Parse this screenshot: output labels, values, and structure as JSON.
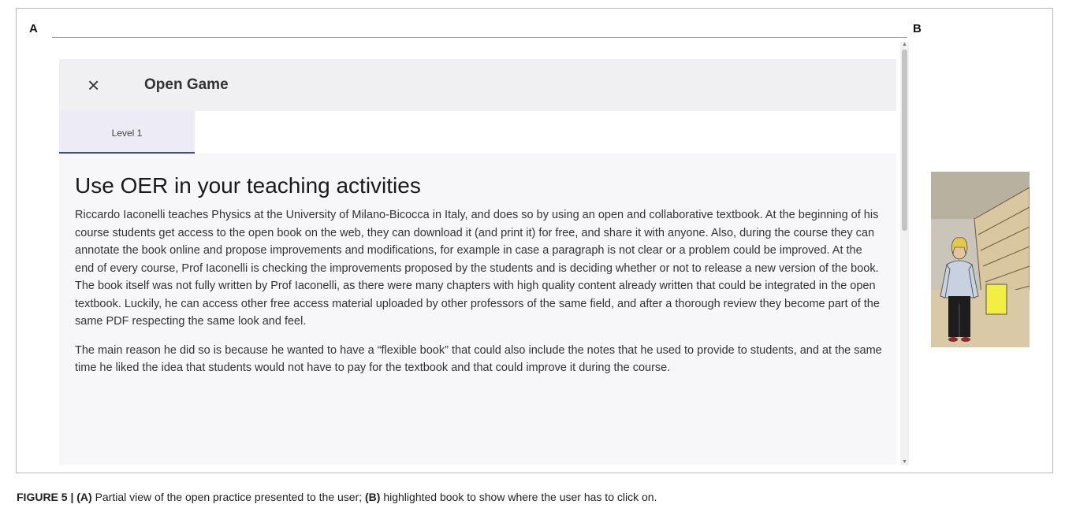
{
  "figure": {
    "label_a": "A",
    "label_b": "B",
    "caption_prefix": "FIGURE 5 | ",
    "caption_a_tag": "(A)",
    "caption_a_text": " Partial view of the open practice presented to the user; ",
    "caption_b_tag": "(B)",
    "caption_b_text": " highlighted book to show where the user has to click on."
  },
  "dialog": {
    "close_symbol": "×",
    "title": "Open Game",
    "tabs": [
      {
        "label": "Level 1",
        "active": true
      }
    ]
  },
  "content": {
    "heading": "Use OER in your teaching activities",
    "paragraphs": [
      "Riccardo Iaconelli teaches Physics at the University of Milano-Bicocca in Italy, and does so by using an open and collaborative textbook. At the beginning of his course students get access to the open book on the web, they can download it (and print it) for free, and share it with anyone. Also, during the course they can annotate the book online and propose improvements and modifications, for example in case a paragraph is not clear or a problem could be improved. At the end of every course, Prof Iaconelli is checking the improvements proposed by the students and is deciding whether or not to release a new version of the book. The book itself was not fully written by Prof Iaconelli, as there were many chapters with high quality content already written that could be integrated in the open textbook. Luckily, he can access other free access material uploaded by other professors of the same field, and after a thorough review they become part of the same PDF respecting the same look and feel.",
      "The main reason he did so is because he wanted to have a “flexible book” that could also include the notes that he used to provide to students, and at the same time he liked the idea that students would not have to pay for the textbook and that could improve it during the course."
    ]
  },
  "scrollbar": {
    "up_arrow": "▲",
    "down_arrow": "▼"
  },
  "icons": {
    "close": "close-icon",
    "scroll_up": "scroll-up-icon",
    "scroll_down": "scroll-down-icon"
  },
  "colors": {
    "tab_accent": "#3f4b9c",
    "book_highlight": "#f2ee43",
    "tab_bg": "#ecebf6"
  }
}
